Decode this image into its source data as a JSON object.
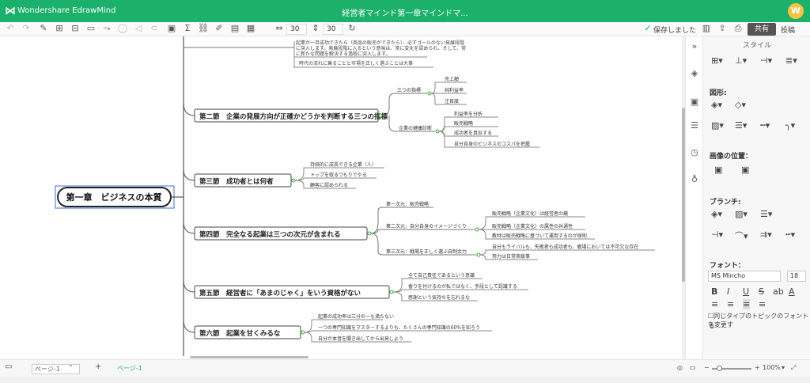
{
  "titlebar": {
    "logo": "⋈",
    "app_name": "Wondershare EdrawMind",
    "doc_title": "経営者マインド第一章マインドマ...",
    "avatar": "W"
  },
  "toolbar": {
    "width_value": "30",
    "height_value": "30",
    "save_status": "保存しました",
    "share_label": "共有",
    "post_label": "投稿"
  },
  "canvas": {
    "top_texts": [
      "起業が一旦成功できたら（商品の販売ができたら）、必ずゴールのない発展段階",
      "に突入します。発展段階に入るという意味は、常に変化を認められ、そして、常",
      "に新たな問題を解決する過程に突入します。",
      "時代の流れに乗ることと市場を正しく選ぶことは大事"
    ],
    "central": "第一章　ビジネスの本質",
    "sections": [
      {
        "title": "第二節　企業の発展方向が正確かどうかを判断する三つの指標",
        "subs": [
          {
            "label": "三つの指標",
            "items": [
              "売上額",
              "純利益率",
              "注目度"
            ]
          },
          {
            "label": "企業の健康診断",
            "items": [
              "利益率を分析",
              "販売戦略",
              "成功者を真似する",
              "自分自身のビジネスのコスパを把握"
            ]
          }
        ]
      },
      {
        "title": "第三節　成功者とは何者",
        "items": [
          "持続的に成長できる企業（人）",
          "トップを取るつもりでやる",
          "顧客に認められる"
        ]
      },
      {
        "title": "第四節　完全なる起業は三つの次元が含まれる",
        "subs": [
          {
            "label": "第一次元：販売戦略",
            "items": []
          },
          {
            "label": "第二次元：自分自身のイメージづくり",
            "items": [
              "販売戦略（企業文化）は経営者の鏡",
              "販売戦略（企業文化）の属性の共通性",
              "教材は販売戦略に基づいて運用するのが原則"
            ]
          },
          {
            "label": "第三次元：戦場を正しく選ぶ自制余力",
            "items": [
              "自分もライバルも、失敗者も成功者も、戦場においては不可欠な存在",
              "努力は日常茶飯事"
            ]
          }
        ]
      },
      {
        "title": "第五節　経営者に「あまのじゃく」をいう資格がない",
        "items": [
          "全て自己責任であるという意識",
          "香りを付けるのが私ではなく、手段として認識する",
          "感謝という気持ちを忘れるな"
        ]
      },
      {
        "title": "第六節　起業を甘くみるな",
        "items": [
          "起業の成功率は三分の一も満たない",
          "一つの専門知識をマスターするよりも、たくさんの専門知識の60%を知ろう",
          "自分が本音を聞き出してから出発しよう"
        ]
      }
    ]
  },
  "panel": {
    "title": "スタイル",
    "shape_label": "図形:",
    "image_pos_label": "画像の位置：",
    "branch_label": "ブランチ:",
    "font_label": "フォント：",
    "font_family": "MS Mincho",
    "font_size": "18",
    "same_type_label": "同じタイプのトピックのフォントを変更す"
  },
  "statusbar": {
    "page_select": "ページ-1",
    "page_tab": "ページ-1",
    "add": "+",
    "zoom": "100%"
  }
}
